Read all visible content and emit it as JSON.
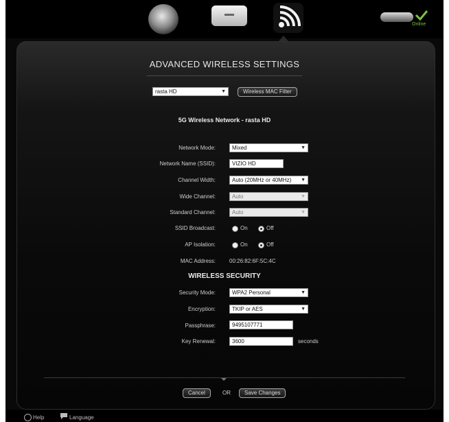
{
  "header": {
    "nav_icons": [
      "globe-icon",
      "router-icon",
      "wifi-icon"
    ],
    "status_label": "Online",
    "status_icon": "check-icon"
  },
  "page": {
    "title": "ADVANCED WIRELESS SETTINGS"
  },
  "network_selector": {
    "selected": "rasta HD",
    "mac_filter_label": "Wireless MAC Filter"
  },
  "network_heading": "5G Wireless Network  -  rasta HD",
  "settings": {
    "network_mode": {
      "label": "Network Mode:",
      "value": "Mixed"
    },
    "network_name": {
      "label": "Network Name (SSID):",
      "value": "VIZIO HD"
    },
    "channel_width": {
      "label": "Channel Width:",
      "value": "Auto (20MHz or 40MHz)"
    },
    "wide_channel": {
      "label": "Wide Channel:",
      "value": "Auto"
    },
    "standard_channel": {
      "label": "Standard Channel:",
      "value": "Auto"
    },
    "ssid_broadcast": {
      "label": "SSID Broadcast:",
      "on": "On",
      "off": "Off",
      "selected": "Off"
    },
    "ap_isolation": {
      "label": "AP Isolation:",
      "on": "On",
      "off": "Off",
      "selected": "Off"
    },
    "mac_address": {
      "label": "MAC Address:",
      "value": "00:26:82:6F:5C:4C"
    }
  },
  "security": {
    "heading": "WIRELESS SECURITY",
    "security_mode": {
      "label": "Security Mode:",
      "value": "WPA2 Personal"
    },
    "encryption": {
      "label": "Encryption:",
      "value": "TKIP or AES"
    },
    "passphrase": {
      "label": "Passphrase:",
      "value": "9495107771"
    },
    "key_renewal": {
      "label": "Key Renewal:",
      "value": "3600",
      "unit": "seconds"
    }
  },
  "actions": {
    "cancel_label": "Cancel",
    "or_label": "OR",
    "save_label": "Save Changes"
  },
  "footer": {
    "help_label": "Help",
    "language_label": "Language"
  }
}
